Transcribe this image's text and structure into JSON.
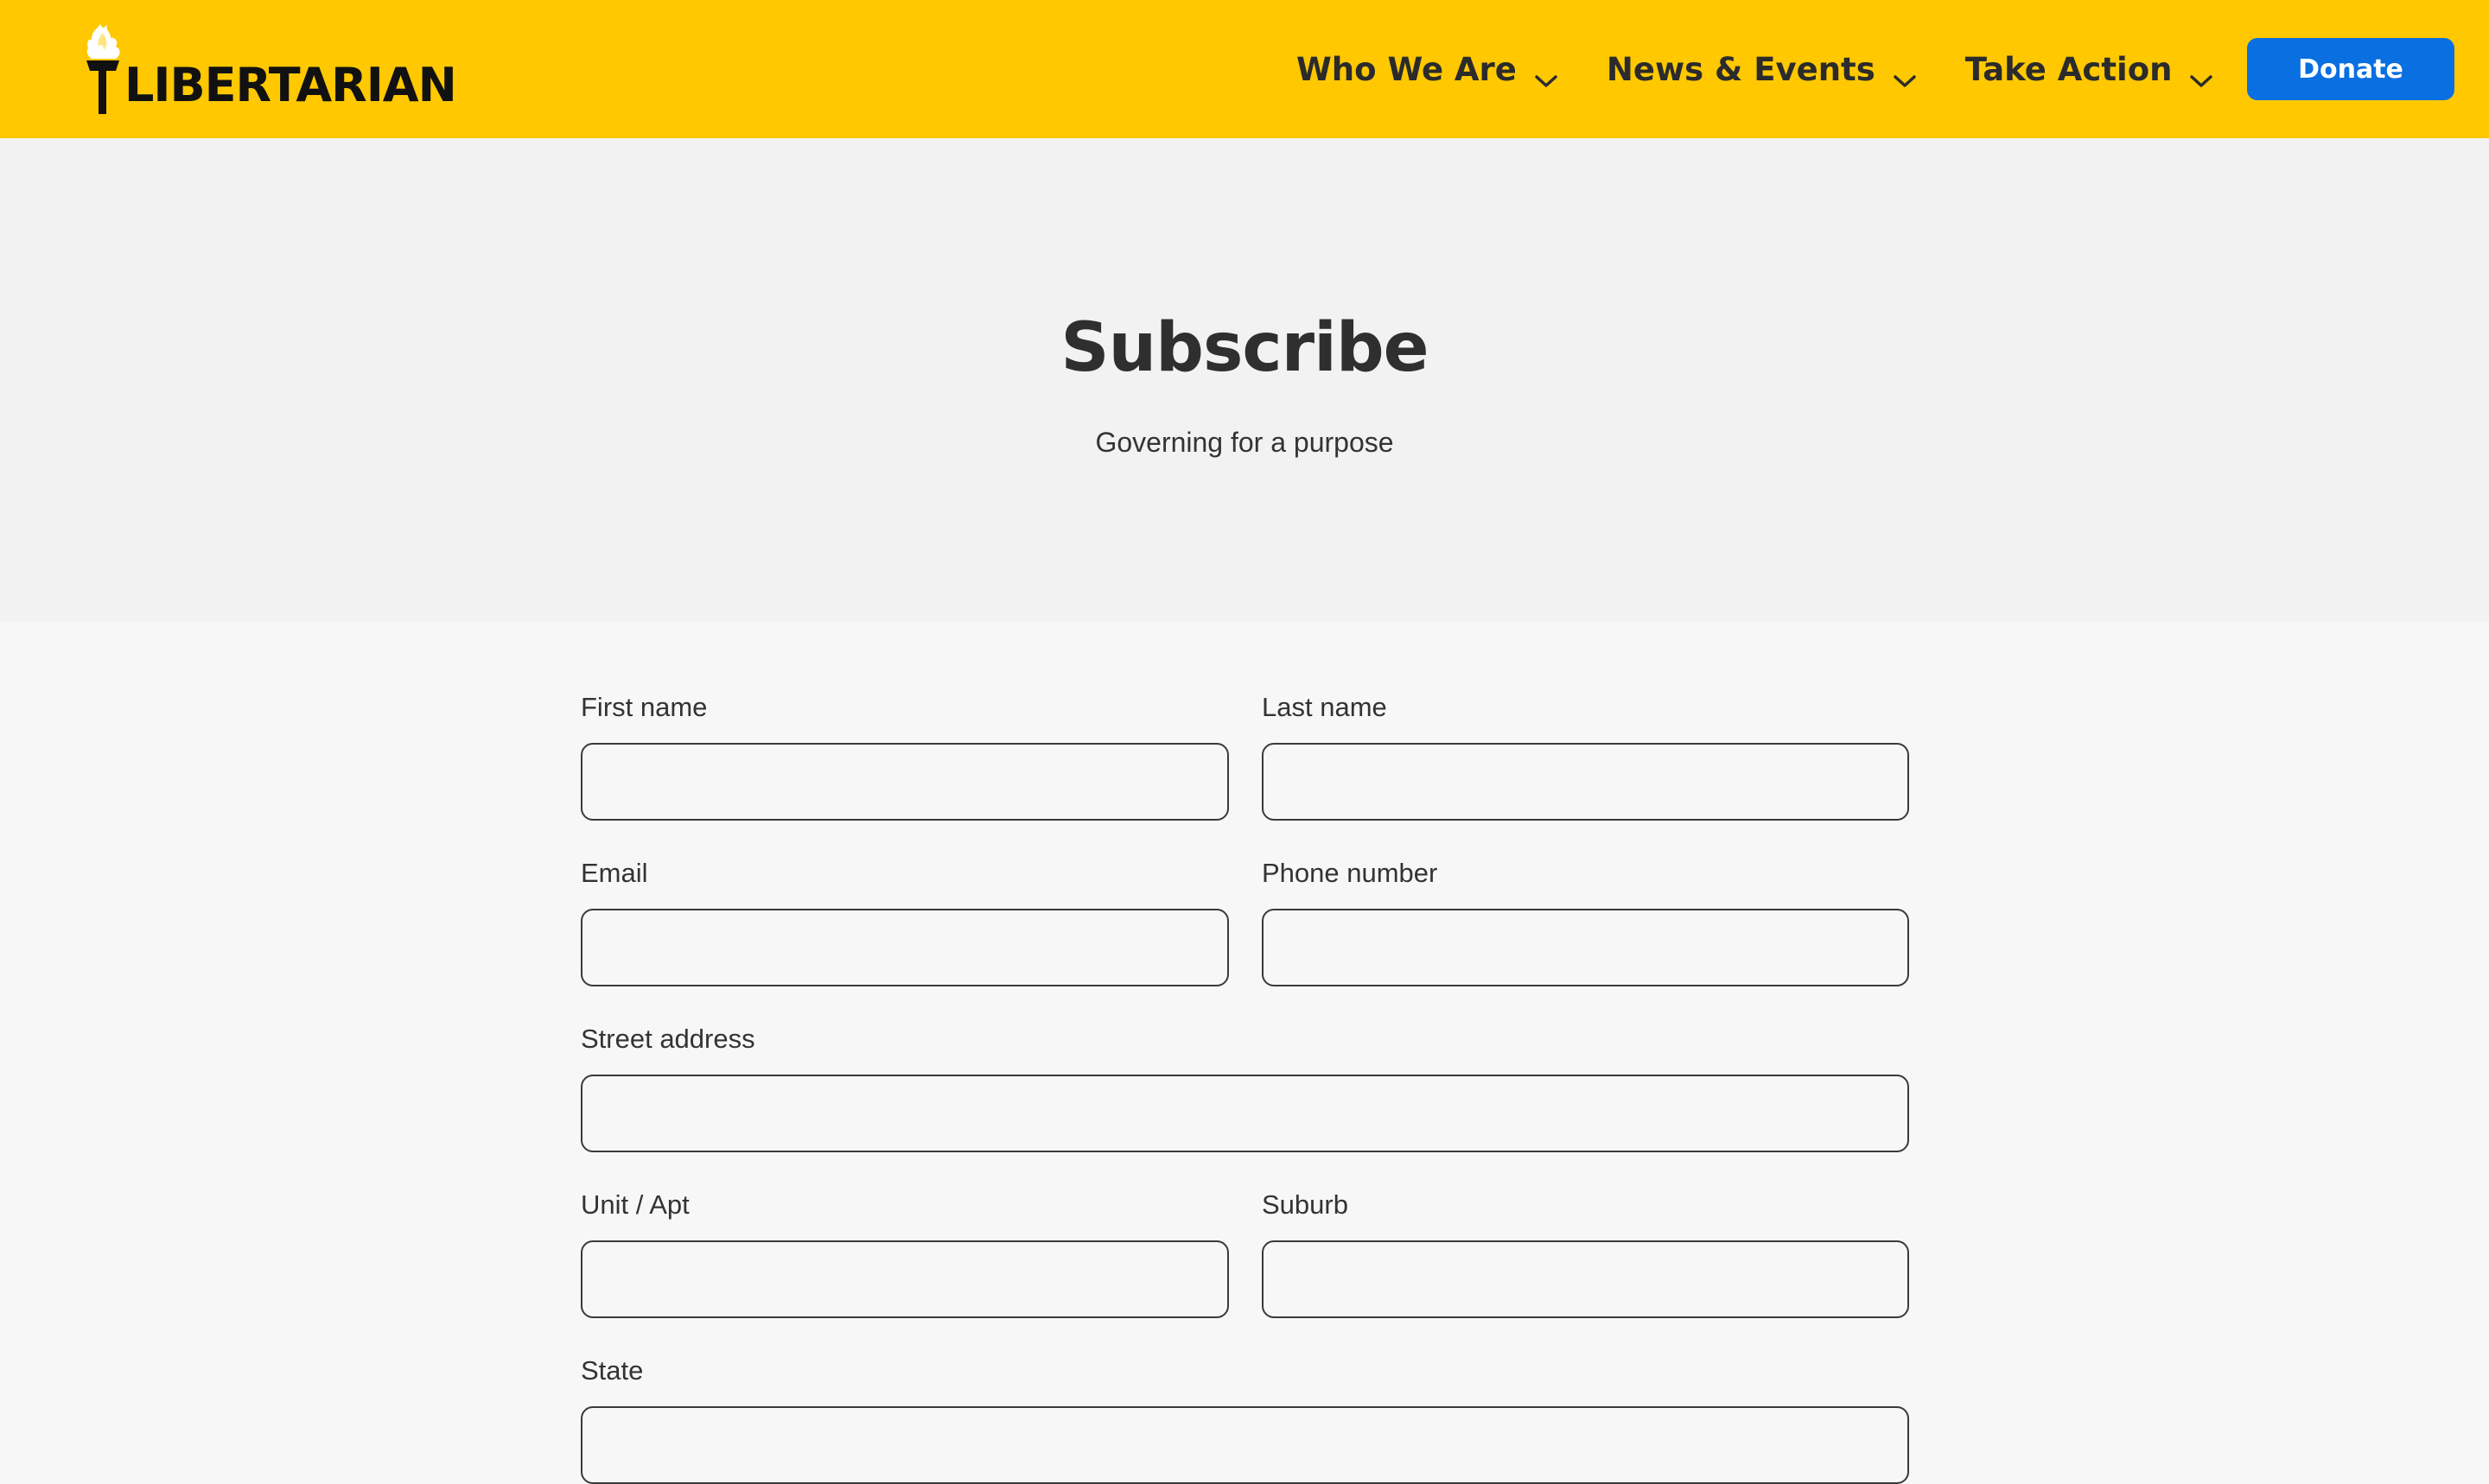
{
  "header": {
    "logo_text": "LIBERTARIAN",
    "nav": [
      {
        "label": "Who We Are"
      },
      {
        "label": "News & Events"
      },
      {
        "label": "Take Action"
      }
    ],
    "donate_label": "Donate"
  },
  "hero": {
    "title": "Subscribe",
    "subtitle": "Governing for a purpose"
  },
  "form": {
    "first_name_label": "First name",
    "last_name_label": "Last name",
    "email_label": "Email",
    "phone_label": "Phone number",
    "street_label": "Street address",
    "unit_label": "Unit / Apt",
    "suburb_label": "Suburb",
    "state_label": "State"
  },
  "icons": {
    "logo": "torch-icon",
    "nav_chevron": "chevron-down-icon"
  },
  "colors": {
    "header_bg": "#ffc800",
    "donate_bg": "#0a6fe0",
    "hero_bg": "#f2f2f2",
    "page_bg": "#f7f7f7"
  }
}
